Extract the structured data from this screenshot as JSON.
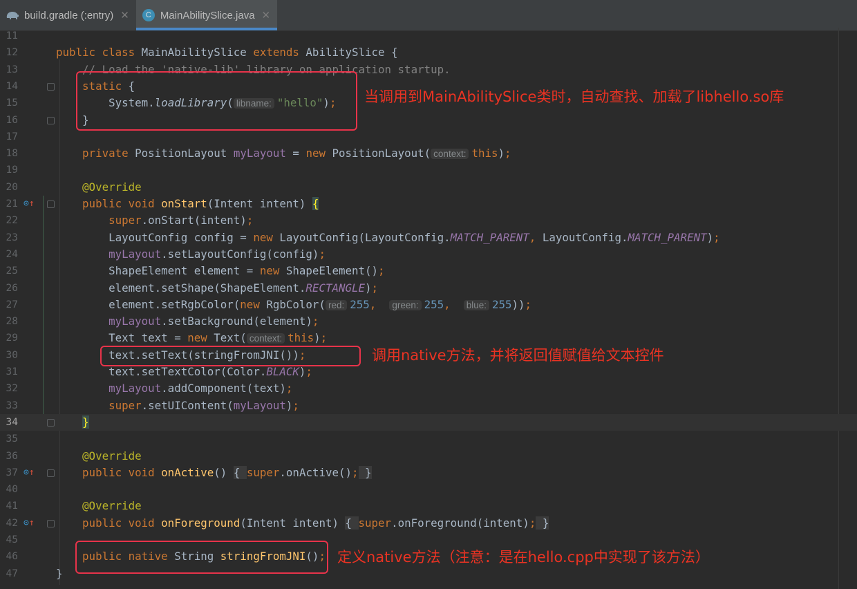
{
  "tabs": [
    {
      "label": "build.gradle (:entry)",
      "icon": "gradle-elephant-icon",
      "active": false
    },
    {
      "label": "MainAbilitySlice.java",
      "icon": "java-class-icon",
      "icon_letter": "C",
      "active": true
    }
  ],
  "colors": {
    "keyword": "#cc7832",
    "field": "#9876aa",
    "string": "#6a8759",
    "number": "#6897bb",
    "annotation": "#bbb529",
    "method": "#ffc66d",
    "annotation_red": "#ea3323",
    "background": "#2b2b2b"
  },
  "current_line": "34",
  "lines": [
    {
      "n": "11",
      "t": []
    },
    {
      "n": "12",
      "t": [
        [
          "public class ",
          "k"
        ],
        [
          "MainAbilitySlice ",
          ""
        ],
        [
          "extends ",
          "k"
        ],
        [
          "AbilitySlice {",
          ""
        ]
      ]
    },
    {
      "n": "13",
      "t": [
        [
          "    // Load the 'native-lib' library on application startup.",
          "cm"
        ]
      ]
    },
    {
      "n": "14",
      "fold": true,
      "t": [
        [
          "    static ",
          "k"
        ],
        [
          "{",
          ""
        ]
      ]
    },
    {
      "n": "15",
      "t": [
        [
          "        System.",
          ""
        ],
        [
          "loadLibrary",
          "i"
        ],
        [
          "(",
          ""
        ],
        [
          "libname:",
          "h"
        ],
        [
          "\"hello\"",
          "s"
        ],
        [
          ")",
          ""
        ],
        [
          ";",
          "k"
        ]
      ]
    },
    {
      "n": "16",
      "fold": true,
      "t": [
        [
          "    }",
          ""
        ]
      ]
    },
    {
      "n": "17",
      "t": []
    },
    {
      "n": "18",
      "t": [
        [
          "    private ",
          "k"
        ],
        [
          "PositionLayout ",
          ""
        ],
        [
          "myLayout",
          "f"
        ],
        [
          " = ",
          ""
        ],
        [
          "new ",
          "k"
        ],
        [
          "PositionLayout(",
          ""
        ],
        [
          "context:",
          "h"
        ],
        [
          "this",
          "k"
        ],
        [
          ")",
          ""
        ],
        [
          ";",
          "k"
        ]
      ]
    },
    {
      "n": "19",
      "t": []
    },
    {
      "n": "20",
      "t": [
        [
          "    @Override",
          "a"
        ]
      ]
    },
    {
      "n": "21",
      "icon": true,
      "fold": true,
      "t": [
        [
          "    public void ",
          "k"
        ],
        [
          "onStart",
          "m"
        ],
        [
          "(Intent intent) ",
          ""
        ],
        [
          "{",
          "br"
        ]
      ]
    },
    {
      "n": "22",
      "t": [
        [
          "        super",
          "k"
        ],
        [
          ".onStart(intent)",
          ""
        ],
        [
          ";",
          "k"
        ]
      ]
    },
    {
      "n": "23",
      "t": [
        [
          "        LayoutConfig config = ",
          ""
        ],
        [
          "new ",
          "k"
        ],
        [
          "LayoutConfig(LayoutConfig.",
          ""
        ],
        [
          "MATCH_PARENT",
          "c"
        ],
        [
          ", ",
          "k"
        ],
        [
          "LayoutConfig.",
          ""
        ],
        [
          "MATCH_PARENT",
          "c"
        ],
        [
          ")",
          ""
        ],
        [
          ";",
          "k"
        ]
      ]
    },
    {
      "n": "24",
      "t": [
        [
          "        myLayout",
          "f"
        ],
        [
          ".setLayoutConfig(config)",
          ""
        ],
        [
          ";",
          "k"
        ]
      ]
    },
    {
      "n": "25",
      "t": [
        [
          "        ShapeElement element = ",
          ""
        ],
        [
          "new ",
          "k"
        ],
        [
          "ShapeElement()",
          ""
        ],
        [
          ";",
          "k"
        ]
      ]
    },
    {
      "n": "26",
      "t": [
        [
          "        element.setShape(ShapeElement.",
          ""
        ],
        [
          "RECTANGLE",
          "c"
        ],
        [
          ")",
          ""
        ],
        [
          ";",
          "k"
        ]
      ]
    },
    {
      "n": "27",
      "t": [
        [
          "        element.setRgbColor(",
          ""
        ],
        [
          "new ",
          "k"
        ],
        [
          "RgbColor(",
          ""
        ],
        [
          "red:",
          "h"
        ],
        [
          "255",
          "n"
        ],
        [
          ",  ",
          "k"
        ],
        [
          "green:",
          "h"
        ],
        [
          "255",
          "n"
        ],
        [
          ",  ",
          "k"
        ],
        [
          "blue:",
          "h"
        ],
        [
          "255",
          "n"
        ],
        [
          "))",
          ""
        ],
        [
          ";",
          "k"
        ]
      ]
    },
    {
      "n": "28",
      "t": [
        [
          "        myLayout",
          "f"
        ],
        [
          ".setBackground(element)",
          ""
        ],
        [
          ";",
          "k"
        ]
      ]
    },
    {
      "n": "29",
      "t": [
        [
          "        Text text = ",
          ""
        ],
        [
          "new ",
          "k"
        ],
        [
          "Text(",
          ""
        ],
        [
          "context:",
          "h"
        ],
        [
          "this",
          "k"
        ],
        [
          ")",
          ""
        ],
        [
          ";",
          "k"
        ]
      ]
    },
    {
      "n": "30",
      "t": [
        [
          "        text.setText(stringFromJNI())",
          ""
        ],
        [
          ";",
          "k"
        ]
      ]
    },
    {
      "n": "31",
      "t": [
        [
          "        text.setTextColor(Color.",
          ""
        ],
        [
          "BLACK",
          "c"
        ],
        [
          ")",
          ""
        ],
        [
          ";",
          "k"
        ]
      ]
    },
    {
      "n": "32",
      "t": [
        [
          "        myLayout",
          "f"
        ],
        [
          ".addComponent(text)",
          ""
        ],
        [
          ";",
          "k"
        ]
      ]
    },
    {
      "n": "33",
      "t": [
        [
          "        super",
          "k"
        ],
        [
          ".setUIContent(",
          ""
        ],
        [
          "myLayout",
          "f"
        ],
        [
          ")",
          ""
        ],
        [
          ";",
          "k"
        ]
      ]
    },
    {
      "n": "34",
      "fold": true,
      "t": [
        [
          "    ",
          ""
        ],
        [
          "}",
          "br"
        ]
      ]
    },
    {
      "n": "35",
      "t": []
    },
    {
      "n": "36",
      "t": [
        [
          "    @Override",
          "a"
        ]
      ]
    },
    {
      "n": "37",
      "icon": true,
      "fold": true,
      "t": [
        [
          "    public void ",
          "k"
        ],
        [
          "onActive",
          "m"
        ],
        [
          "() ",
          ""
        ],
        [
          "{ ",
          "fb"
        ],
        [
          "super",
          "k"
        ],
        [
          ".onActive()",
          ""
        ],
        [
          ";",
          "k"
        ],
        [
          " }",
          "fb"
        ]
      ]
    },
    {
      "n": "40",
      "t": []
    },
    {
      "n": "41",
      "t": [
        [
          "    @Override",
          "a"
        ]
      ]
    },
    {
      "n": "42",
      "icon": true,
      "fold": true,
      "t": [
        [
          "    public void ",
          "k"
        ],
        [
          "onForeground",
          "m"
        ],
        [
          "(Intent intent) ",
          ""
        ],
        [
          "{ ",
          "fb"
        ],
        [
          "super",
          "k"
        ],
        [
          ".onForeground(intent)",
          ""
        ],
        [
          ";",
          "k"
        ],
        [
          " }",
          "fb"
        ]
      ]
    },
    {
      "n": "45",
      "t": []
    },
    {
      "n": "46",
      "t": [
        [
          "    public native ",
          "k"
        ],
        [
          "String ",
          ""
        ],
        [
          "stringFromJNI",
          "m"
        ],
        [
          "()",
          ""
        ],
        [
          ";",
          "k"
        ]
      ]
    },
    {
      "n": "47",
      "t": [
        [
          "}",
          ""
        ]
      ]
    }
  ],
  "annotations": [
    "当调用到MainAbilitySlice类时，自动查找、加载了libhello.so库",
    "调用native方法，并将返回值赋值给文本控件",
    "定义native方法（注意：是在hello.cpp中实现了该方法）"
  ]
}
